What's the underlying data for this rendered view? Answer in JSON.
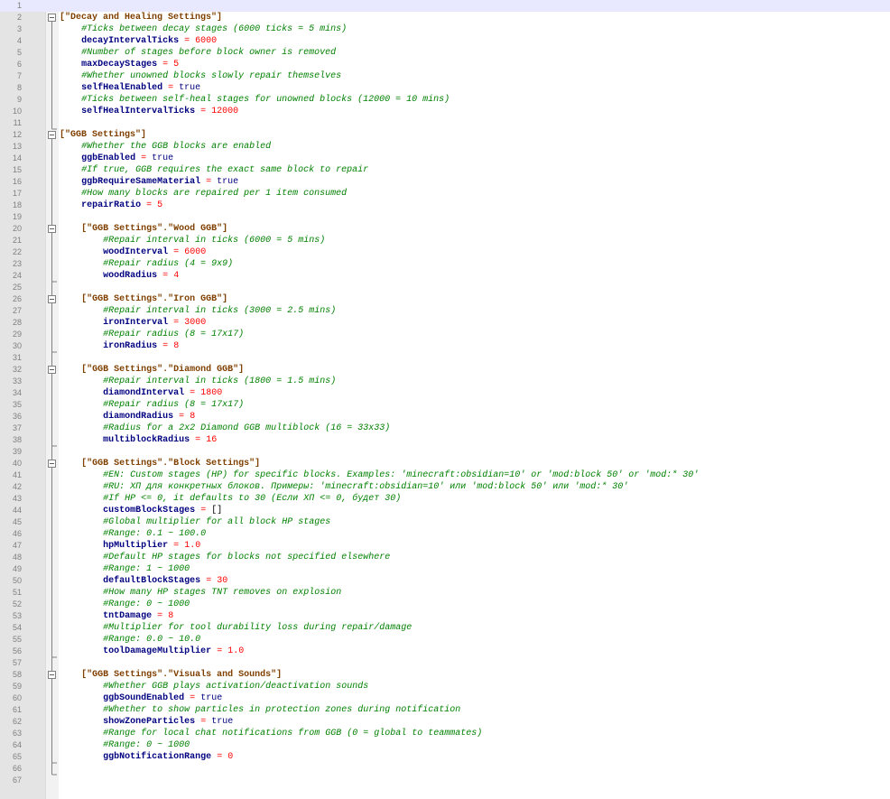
{
  "editor": {
    "colors": {
      "gutter": "#e4e4e4",
      "current_line": "#e8e8ff",
      "header": "#804000",
      "comment": "#008000",
      "key": "#000080",
      "number": "#ff0000"
    },
    "lines": [
      {
        "n": "1",
        "tokens": []
      },
      {
        "n": "2",
        "fold": "open",
        "tokens": [
          {
            "t": "header",
            "v": "[\"Decay and Healing Settings\"]"
          }
        ]
      },
      {
        "n": "3",
        "indent": 4,
        "tokens": [
          {
            "t": "comment",
            "v": "#Ticks between decay stages (6000 ticks = 5 mins)"
          }
        ]
      },
      {
        "n": "4",
        "indent": 4,
        "tokens": [
          {
            "t": "key",
            "v": "decayIntervalTicks"
          },
          {
            "t": "op",
            "v": " = "
          },
          {
            "t": "num",
            "v": "6000"
          }
        ]
      },
      {
        "n": "5",
        "indent": 4,
        "tokens": [
          {
            "t": "comment",
            "v": "#Number of stages before block owner is removed"
          }
        ]
      },
      {
        "n": "6",
        "indent": 4,
        "tokens": [
          {
            "t": "key",
            "v": "maxDecayStages"
          },
          {
            "t": "op",
            "v": " = "
          },
          {
            "t": "num",
            "v": "5"
          }
        ]
      },
      {
        "n": "7",
        "indent": 4,
        "tokens": [
          {
            "t": "comment",
            "v": "#Whether unowned blocks slowly repair themselves"
          }
        ]
      },
      {
        "n": "8",
        "indent": 4,
        "tokens": [
          {
            "t": "key",
            "v": "selfHealEnabled"
          },
          {
            "t": "op",
            "v": " = "
          },
          {
            "t": "bool",
            "v": "true"
          }
        ]
      },
      {
        "n": "9",
        "indent": 4,
        "tokens": [
          {
            "t": "comment",
            "v": "#Ticks between self-heal stages for unowned blocks (12000 = 10 mins)"
          }
        ]
      },
      {
        "n": "10",
        "indent": 4,
        "tokens": [
          {
            "t": "key",
            "v": "selfHealIntervalTicks"
          },
          {
            "t": "op",
            "v": " = "
          },
          {
            "t": "num",
            "v": "12000"
          }
        ]
      },
      {
        "n": "11",
        "tokens": []
      },
      {
        "n": "12",
        "fold": "open",
        "tokens": [
          {
            "t": "header",
            "v": "[\"GGB Settings\"]"
          }
        ]
      },
      {
        "n": "13",
        "indent": 4,
        "tokens": [
          {
            "t": "comment",
            "v": "#Whether the GGB blocks are enabled"
          }
        ]
      },
      {
        "n": "14",
        "indent": 4,
        "tokens": [
          {
            "t": "key",
            "v": "ggbEnabled"
          },
          {
            "t": "op",
            "v": " = "
          },
          {
            "t": "bool",
            "v": "true"
          }
        ]
      },
      {
        "n": "15",
        "indent": 4,
        "tokens": [
          {
            "t": "comment",
            "v": "#If true, GGB requires the exact same block to repair"
          }
        ]
      },
      {
        "n": "16",
        "indent": 4,
        "tokens": [
          {
            "t": "key",
            "v": "ggbRequireSameMaterial"
          },
          {
            "t": "op",
            "v": " = "
          },
          {
            "t": "bool",
            "v": "true"
          }
        ]
      },
      {
        "n": "17",
        "indent": 4,
        "tokens": [
          {
            "t": "comment",
            "v": "#How many blocks are repaired per 1 item consumed"
          }
        ]
      },
      {
        "n": "18",
        "indent": 4,
        "tokens": [
          {
            "t": "key",
            "v": "repairRatio"
          },
          {
            "t": "op",
            "v": " = "
          },
          {
            "t": "num",
            "v": "5"
          }
        ]
      },
      {
        "n": "19",
        "tokens": []
      },
      {
        "n": "20",
        "indent": 4,
        "fold": "open",
        "tokens": [
          {
            "t": "header",
            "v": "[\"GGB Settings\".\"Wood GGB\"]"
          }
        ]
      },
      {
        "n": "21",
        "indent": 8,
        "tokens": [
          {
            "t": "comment",
            "v": "#Repair interval in ticks (6000 = 5 mins)"
          }
        ]
      },
      {
        "n": "22",
        "indent": 8,
        "tokens": [
          {
            "t": "key",
            "v": "woodInterval"
          },
          {
            "t": "op",
            "v": " = "
          },
          {
            "t": "num",
            "v": "6000"
          }
        ]
      },
      {
        "n": "23",
        "indent": 8,
        "tokens": [
          {
            "t": "comment",
            "v": "#Repair radius (4 = 9x9)"
          }
        ]
      },
      {
        "n": "24",
        "indent": 8,
        "tokens": [
          {
            "t": "key",
            "v": "woodRadius"
          },
          {
            "t": "op",
            "v": " = "
          },
          {
            "t": "num",
            "v": "4"
          }
        ]
      },
      {
        "n": "25",
        "tokens": []
      },
      {
        "n": "26",
        "indent": 4,
        "fold": "open",
        "tokens": [
          {
            "t": "header",
            "v": "[\"GGB Settings\".\"Iron GGB\"]"
          }
        ]
      },
      {
        "n": "27",
        "indent": 8,
        "tokens": [
          {
            "t": "comment",
            "v": "#Repair interval in ticks (3000 = 2.5 mins)"
          }
        ]
      },
      {
        "n": "28",
        "indent": 8,
        "tokens": [
          {
            "t": "key",
            "v": "ironInterval"
          },
          {
            "t": "op",
            "v": " = "
          },
          {
            "t": "num",
            "v": "3000"
          }
        ]
      },
      {
        "n": "29",
        "indent": 8,
        "tokens": [
          {
            "t": "comment",
            "v": "#Repair radius (8 = 17x17)"
          }
        ]
      },
      {
        "n": "30",
        "indent": 8,
        "tokens": [
          {
            "t": "key",
            "v": "ironRadius"
          },
          {
            "t": "op",
            "v": " = "
          },
          {
            "t": "num",
            "v": "8"
          }
        ]
      },
      {
        "n": "31",
        "tokens": []
      },
      {
        "n": "32",
        "indent": 4,
        "fold": "open",
        "tokens": [
          {
            "t": "header",
            "v": "[\"GGB Settings\".\"Diamond GGB\"]"
          }
        ]
      },
      {
        "n": "33",
        "indent": 8,
        "tokens": [
          {
            "t": "comment",
            "v": "#Repair interval in ticks (1800 = 1.5 mins)"
          }
        ]
      },
      {
        "n": "34",
        "indent": 8,
        "tokens": [
          {
            "t": "key",
            "v": "diamondInterval"
          },
          {
            "t": "op",
            "v": " = "
          },
          {
            "t": "num",
            "v": "1800"
          }
        ]
      },
      {
        "n": "35",
        "indent": 8,
        "tokens": [
          {
            "t": "comment",
            "v": "#Repair radius (8 = 17x17)"
          }
        ]
      },
      {
        "n": "36",
        "indent": 8,
        "tokens": [
          {
            "t": "key",
            "v": "diamondRadius"
          },
          {
            "t": "op",
            "v": " = "
          },
          {
            "t": "num",
            "v": "8"
          }
        ]
      },
      {
        "n": "37",
        "indent": 8,
        "tokens": [
          {
            "t": "comment",
            "v": "#Radius for a 2x2 Diamond GGB multiblock (16 = 33x33)"
          }
        ]
      },
      {
        "n": "38",
        "indent": 8,
        "tokens": [
          {
            "t": "key",
            "v": "multiblockRadius"
          },
          {
            "t": "op",
            "v": " = "
          },
          {
            "t": "num",
            "v": "16"
          }
        ]
      },
      {
        "n": "39",
        "tokens": []
      },
      {
        "n": "40",
        "indent": 4,
        "fold": "open",
        "tokens": [
          {
            "t": "header",
            "v": "[\"GGB Settings\".\"Block Settings\"]"
          }
        ]
      },
      {
        "n": "41",
        "indent": 8,
        "tokens": [
          {
            "t": "comment",
            "v": "#EN: Custom stages (HP) for specific blocks. Examples: 'minecraft:obsidian=10' or 'mod:block 50' or 'mod:* 30'"
          }
        ]
      },
      {
        "n": "42",
        "indent": 8,
        "tokens": [
          {
            "t": "comment",
            "v": "#RU: ХП для конкретных блоков. Примеры: 'minecraft:obsidian=10' или 'mod:block 50' или 'mod:* 30'"
          }
        ]
      },
      {
        "n": "43",
        "indent": 8,
        "tokens": [
          {
            "t": "comment",
            "v": "#If HP <= 0, it defaults to 30 (Если ХП <= 0, будет 30)"
          }
        ]
      },
      {
        "n": "44",
        "indent": 8,
        "tokens": [
          {
            "t": "key",
            "v": "customBlockStages"
          },
          {
            "t": "op",
            "v": " = "
          },
          {
            "t": "val",
            "v": "[]"
          }
        ]
      },
      {
        "n": "45",
        "indent": 8,
        "tokens": [
          {
            "t": "comment",
            "v": "#Global multiplier for all block HP stages"
          }
        ]
      },
      {
        "n": "46",
        "indent": 8,
        "tokens": [
          {
            "t": "comment",
            "v": "#Range: 0.1 ~ 100.0"
          }
        ]
      },
      {
        "n": "47",
        "indent": 8,
        "tokens": [
          {
            "t": "key",
            "v": "hpMultiplier"
          },
          {
            "t": "op",
            "v": " = "
          },
          {
            "t": "num",
            "v": "1.0"
          }
        ]
      },
      {
        "n": "48",
        "indent": 8,
        "tokens": [
          {
            "t": "comment",
            "v": "#Default HP stages for blocks not specified elsewhere"
          }
        ]
      },
      {
        "n": "49",
        "indent": 8,
        "tokens": [
          {
            "t": "comment",
            "v": "#Range: 1 ~ 1000"
          }
        ]
      },
      {
        "n": "50",
        "indent": 8,
        "tokens": [
          {
            "t": "key",
            "v": "defaultBlockStages"
          },
          {
            "t": "op",
            "v": " = "
          },
          {
            "t": "num",
            "v": "30"
          }
        ]
      },
      {
        "n": "51",
        "indent": 8,
        "tokens": [
          {
            "t": "comment",
            "v": "#How many HP stages TNT removes on explosion"
          }
        ]
      },
      {
        "n": "52",
        "indent": 8,
        "tokens": [
          {
            "t": "comment",
            "v": "#Range: 0 ~ 1000"
          }
        ]
      },
      {
        "n": "53",
        "indent": 8,
        "tokens": [
          {
            "t": "key",
            "v": "tntDamage"
          },
          {
            "t": "op",
            "v": " = "
          },
          {
            "t": "num",
            "v": "8"
          }
        ]
      },
      {
        "n": "54",
        "indent": 8,
        "tokens": [
          {
            "t": "comment",
            "v": "#Multiplier for tool durability loss during repair/damage"
          }
        ]
      },
      {
        "n": "55",
        "indent": 8,
        "tokens": [
          {
            "t": "comment",
            "v": "#Range: 0.0 ~ 10.0"
          }
        ]
      },
      {
        "n": "56",
        "indent": 8,
        "tokens": [
          {
            "t": "key",
            "v": "toolDamageMultiplier"
          },
          {
            "t": "op",
            "v": " = "
          },
          {
            "t": "num",
            "v": "1.0"
          }
        ]
      },
      {
        "n": "57",
        "tokens": []
      },
      {
        "n": "58",
        "indent": 4,
        "fold": "open",
        "tokens": [
          {
            "t": "header",
            "v": "[\"GGB Settings\".\"Visuals and Sounds\"]"
          }
        ]
      },
      {
        "n": "59",
        "indent": 8,
        "tokens": [
          {
            "t": "comment",
            "v": "#Whether GGB plays activation/deactivation sounds"
          }
        ]
      },
      {
        "n": "60",
        "indent": 8,
        "tokens": [
          {
            "t": "key",
            "v": "ggbSoundEnabled"
          },
          {
            "t": "op",
            "v": " = "
          },
          {
            "t": "bool",
            "v": "true"
          }
        ]
      },
      {
        "n": "61",
        "indent": 8,
        "tokens": [
          {
            "t": "comment",
            "v": "#Whether to show particles in protection zones during notification"
          }
        ]
      },
      {
        "n": "62",
        "indent": 8,
        "tokens": [
          {
            "t": "key",
            "v": "showZoneParticles"
          },
          {
            "t": "op",
            "v": " = "
          },
          {
            "t": "bool",
            "v": "true"
          }
        ]
      },
      {
        "n": "63",
        "indent": 8,
        "tokens": [
          {
            "t": "comment",
            "v": "#Range for local chat notifications from GGB (0 = global to teammates)"
          }
        ]
      },
      {
        "n": "64",
        "indent": 8,
        "tokens": [
          {
            "t": "comment",
            "v": "#Range: 0 ~ 1000"
          }
        ]
      },
      {
        "n": "65",
        "indent": 8,
        "tokens": [
          {
            "t": "key",
            "v": "ggbNotificationRange"
          },
          {
            "t": "op",
            "v": " = "
          },
          {
            "t": "num",
            "v": "0"
          }
        ]
      },
      {
        "n": "66",
        "tokens": []
      },
      {
        "n": "67",
        "tokens": []
      }
    ]
  }
}
